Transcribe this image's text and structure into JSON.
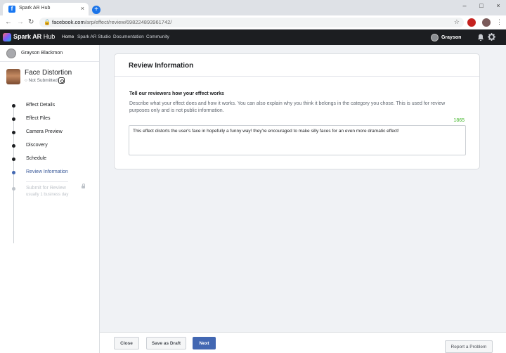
{
  "browser": {
    "tab_title": "Spark AR Hub",
    "tab_favicon": "f",
    "url_domain": "facebook.com",
    "url_path": "/arp/effect/review/698224893961742/"
  },
  "topnav": {
    "brand_bold": "Spark AR",
    "brand_light": " Hub",
    "links": [
      "Home",
      "Spark AR Studio",
      "Documentation",
      "Community"
    ],
    "user_name": "Grayson"
  },
  "sidebar": {
    "user_name": "Grayson Blackmon",
    "effect_title": "Face Distortion",
    "effect_status": "○ Not Submitted",
    "steps": [
      {
        "label": "Effect Details"
      },
      {
        "label": "Effect Files"
      },
      {
        "label": "Camera Preview"
      },
      {
        "label": "Discovery"
      },
      {
        "label": "Schedule"
      },
      {
        "label": "Review Information"
      },
      {
        "label": "Submit for Review"
      }
    ],
    "submit_sub": "usually 1 business day"
  },
  "main": {
    "card_title": "Review Information",
    "question_title": "Tell our reviewers how your effect works",
    "question_desc": "Describe what your effect does and how it works. You can also explain why you think it belongs in the category you chose. This is used for review purposes only and is not public information.",
    "char_count": "1865",
    "description_value": "This effect distorts the user's face in hopefully a funny way! they're encouraged to make silly faces for an even more dramatic effect!"
  },
  "footer": {
    "close_label": "Close",
    "save_label": "Save as Draft",
    "next_label": "Next",
    "report_label": "Report a Problem"
  },
  "colors": {
    "accent": "#4267b2",
    "count_green": "#42b72a",
    "topnav_bg": "#1c1e21"
  }
}
